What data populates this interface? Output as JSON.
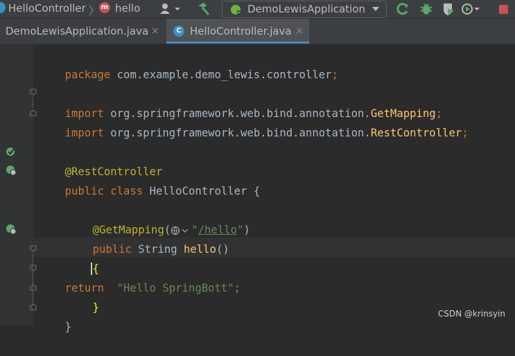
{
  "breadcrumbs": [
    {
      "label": "HelloController",
      "icon": "class-icon",
      "color": "#3592c4"
    },
    {
      "label": "hello",
      "icon": "method-icon",
      "letter": "m",
      "color": "#c75450"
    }
  ],
  "run_config": {
    "label": "DemoLewisApplication"
  },
  "tabs": [
    {
      "label": "DemoLewisApplication.java",
      "close": "×",
      "active": false
    },
    {
      "label": "HelloController.java",
      "close": "×",
      "active": true
    }
  ],
  "code": {
    "line1": {
      "kw": "package ",
      "rest": "com.example.demo_lewis.controller",
      "semi": ";"
    },
    "line3": {
      "kw": "import ",
      "rest": "org.springframework.web.bind.annotation.",
      "cls": "GetMapping",
      "semi": ";"
    },
    "line4": {
      "kw": "import ",
      "rest": "org.springframework.web.bind.annotation.",
      "cls": "RestController",
      "semi": ";"
    },
    "line6": {
      "ann": "@RestController"
    },
    "line7": {
      "kw": "public class ",
      "name": "HelloController ",
      "brace": "{"
    },
    "line9": {
      "ann": "@GetMapping",
      "open": "(",
      "str_open": "\"",
      "url": "/hello",
      "str_close": "\"",
      "close": ")"
    },
    "line10": {
      "kw1": "public ",
      "type": "String ",
      "fn": "hello",
      "parens": "()"
    },
    "line11": {
      "brace": "{"
    },
    "line12": {
      "kw": "return ",
      "str": " \"Hello SpringBott\"",
      "semi": ";"
    },
    "line13": {
      "brace": "}"
    },
    "line14": {
      "brace": "}"
    }
  },
  "watermark": "CSDN @krinsyin"
}
